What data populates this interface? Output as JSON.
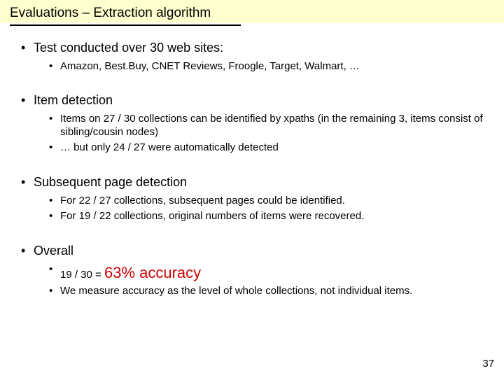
{
  "title": "Evaluations – Extraction algorithm",
  "sections": [
    {
      "heading": "Test conducted over 30 web sites:",
      "sub": [
        "Amazon, Best.Buy, CNET Reviews, Froogle, Target, Walmart, …"
      ]
    },
    {
      "heading": "Item detection",
      "sub": [
        "Items on 27 / 30 collections can be identified by xpaths (in the remaining 3, items consist of sibling/cousin nodes)",
        "… but only 24 / 27 were automatically detected"
      ]
    },
    {
      "heading": "Subsequent page detection",
      "sub": [
        "For 22 / 27 collections, subsequent pages could be identified.",
        "For 19 / 22 collections, original numbers of items were recovered."
      ]
    },
    {
      "heading": "Overall",
      "sub_special": {
        "prefix": "19 / 30 = ",
        "highlight": "63% accuracy"
      },
      "sub2": "We measure accuracy as the level of whole collections, not individual items."
    }
  ],
  "page_number": "37"
}
